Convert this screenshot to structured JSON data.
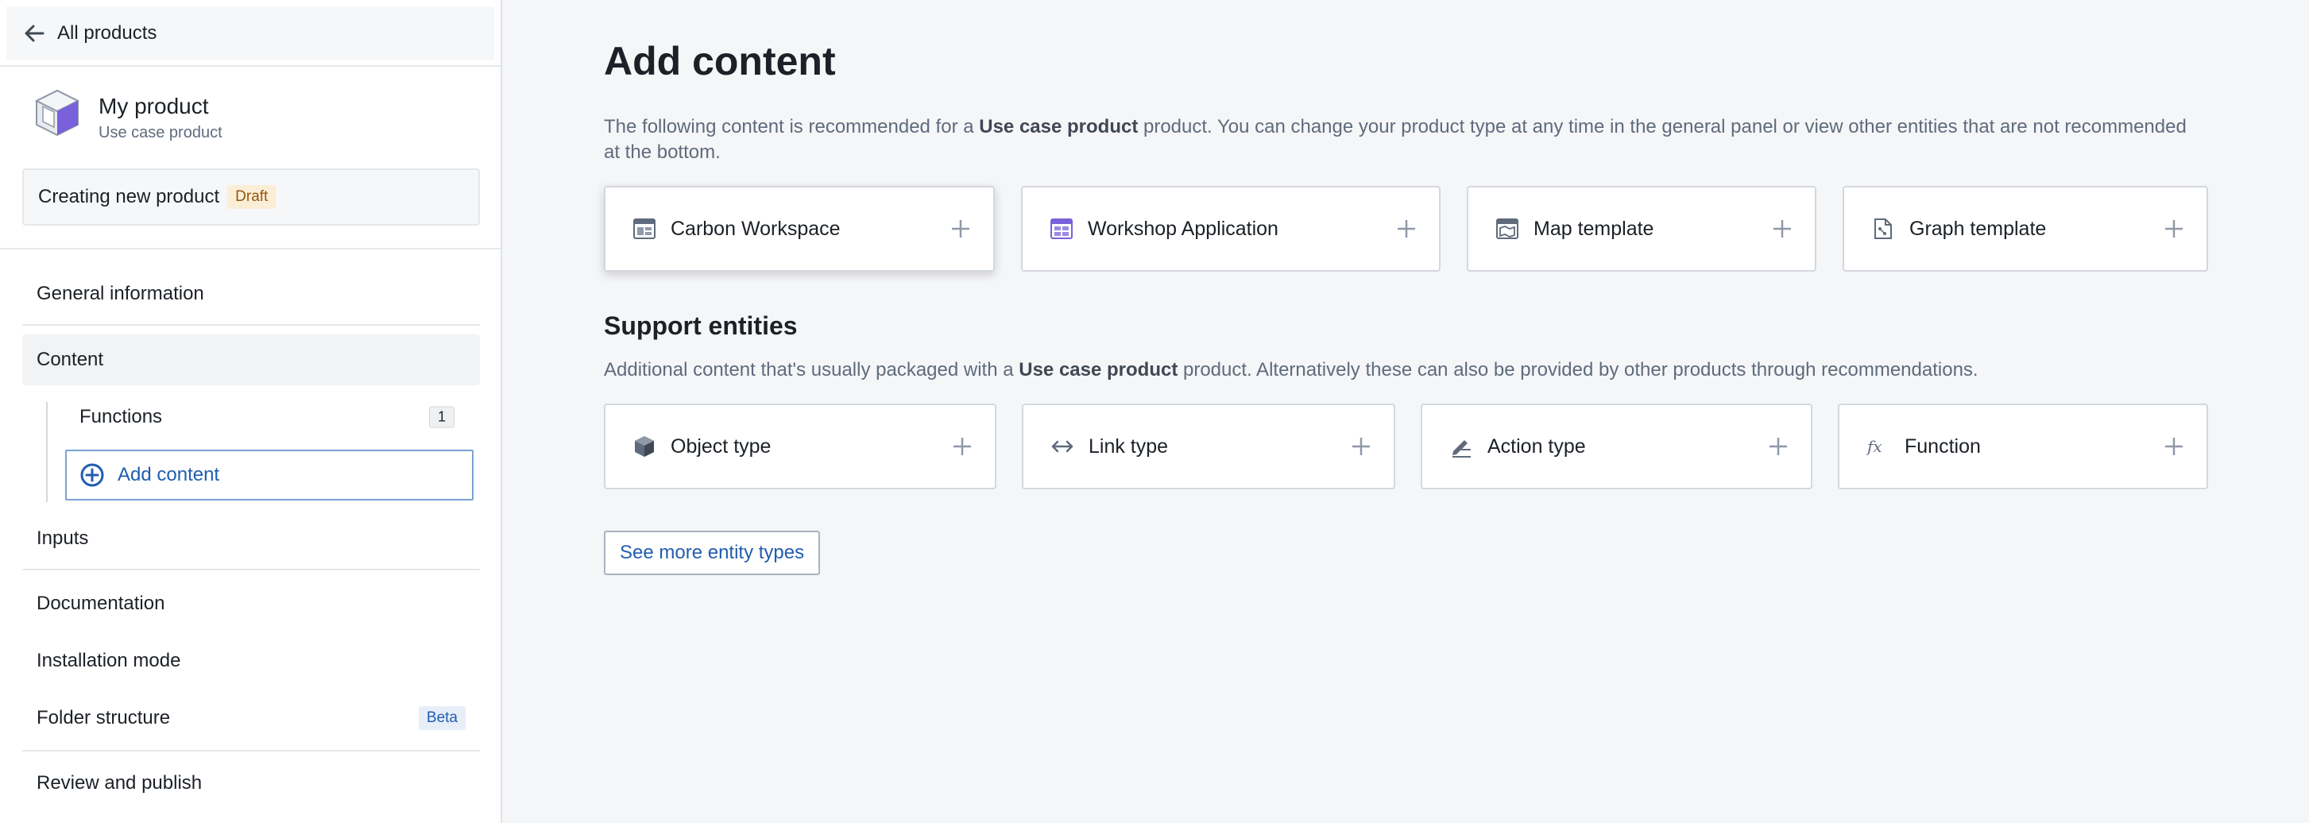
{
  "sidebar": {
    "back_label": "All products",
    "product": {
      "name": "My product",
      "type": "Use case product"
    },
    "status": {
      "label": "Creating new product",
      "badge": "Draft"
    },
    "nav": {
      "general": "General information",
      "content": "Content",
      "functions": {
        "label": "Functions",
        "count": "1"
      },
      "add_content": "Add content",
      "inputs": "Inputs",
      "documentation": "Documentation",
      "installation": "Installation mode",
      "folder": {
        "label": "Folder structure",
        "badge": "Beta"
      },
      "review": "Review and publish"
    }
  },
  "main": {
    "title": "Add content",
    "intro": {
      "before": "The following content is recommended for a ",
      "bold": "Use case product",
      "after": " product. You can change your product type at any time in the general panel or view other entities that are not recommended at the bottom."
    },
    "recommended": [
      {
        "label": "Carbon Workspace",
        "icon": "carbon-workspace-icon"
      },
      {
        "label": "Workshop Application",
        "icon": "workshop-application-icon"
      },
      {
        "label": "Map template",
        "icon": "map-template-icon"
      },
      {
        "label": "Graph template",
        "icon": "graph-template-icon"
      }
    ],
    "support": {
      "title": "Support entities",
      "desc_before": "Additional content that's usually packaged with a ",
      "desc_bold": "Use case product",
      "desc_after": " product. Alternatively these can also be provided by other products through recommendations.",
      "items": [
        {
          "label": "Object type",
          "icon": "object-type-icon"
        },
        {
          "label": "Link type",
          "icon": "link-type-icon"
        },
        {
          "label": "Action type",
          "icon": "action-type-icon"
        },
        {
          "label": "Function",
          "icon": "function-icon"
        }
      ]
    },
    "more_button": "See more entity types"
  },
  "colors": {
    "accent": "#215db0",
    "draft_bg": "#fbeed6",
    "draft_text": "#935610",
    "icon_gray": "#5f6b7c",
    "workshop_purple": "#7961db"
  }
}
